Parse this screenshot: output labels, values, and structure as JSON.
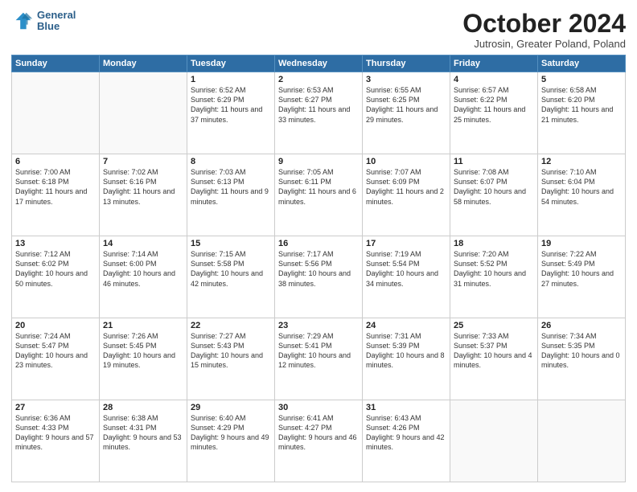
{
  "header": {
    "logo_line1": "General",
    "logo_line2": "Blue",
    "month": "October 2024",
    "location": "Jutrosin, Greater Poland, Poland"
  },
  "days_of_week": [
    "Sunday",
    "Monday",
    "Tuesday",
    "Wednesday",
    "Thursday",
    "Friday",
    "Saturday"
  ],
  "weeks": [
    [
      {
        "day": "",
        "empty": true
      },
      {
        "day": "",
        "empty": true
      },
      {
        "day": "1",
        "sunrise": "6:52 AM",
        "sunset": "6:29 PM",
        "daylight": "11 hours and 37 minutes."
      },
      {
        "day": "2",
        "sunrise": "6:53 AM",
        "sunset": "6:27 PM",
        "daylight": "11 hours and 33 minutes."
      },
      {
        "day": "3",
        "sunrise": "6:55 AM",
        "sunset": "6:25 PM",
        "daylight": "11 hours and 29 minutes."
      },
      {
        "day": "4",
        "sunrise": "6:57 AM",
        "sunset": "6:22 PM",
        "daylight": "11 hours and 25 minutes."
      },
      {
        "day": "5",
        "sunrise": "6:58 AM",
        "sunset": "6:20 PM",
        "daylight": "11 hours and 21 minutes."
      }
    ],
    [
      {
        "day": "6",
        "sunrise": "7:00 AM",
        "sunset": "6:18 PM",
        "daylight": "11 hours and 17 minutes."
      },
      {
        "day": "7",
        "sunrise": "7:02 AM",
        "sunset": "6:16 PM",
        "daylight": "11 hours and 13 minutes."
      },
      {
        "day": "8",
        "sunrise": "7:03 AM",
        "sunset": "6:13 PM",
        "daylight": "11 hours and 9 minutes."
      },
      {
        "day": "9",
        "sunrise": "7:05 AM",
        "sunset": "6:11 PM",
        "daylight": "11 hours and 6 minutes."
      },
      {
        "day": "10",
        "sunrise": "7:07 AM",
        "sunset": "6:09 PM",
        "daylight": "11 hours and 2 minutes."
      },
      {
        "day": "11",
        "sunrise": "7:08 AM",
        "sunset": "6:07 PM",
        "daylight": "10 hours and 58 minutes."
      },
      {
        "day": "12",
        "sunrise": "7:10 AM",
        "sunset": "6:04 PM",
        "daylight": "10 hours and 54 minutes."
      }
    ],
    [
      {
        "day": "13",
        "sunrise": "7:12 AM",
        "sunset": "6:02 PM",
        "daylight": "10 hours and 50 minutes."
      },
      {
        "day": "14",
        "sunrise": "7:14 AM",
        "sunset": "6:00 PM",
        "daylight": "10 hours and 46 minutes."
      },
      {
        "day": "15",
        "sunrise": "7:15 AM",
        "sunset": "5:58 PM",
        "daylight": "10 hours and 42 minutes."
      },
      {
        "day": "16",
        "sunrise": "7:17 AM",
        "sunset": "5:56 PM",
        "daylight": "10 hours and 38 minutes."
      },
      {
        "day": "17",
        "sunrise": "7:19 AM",
        "sunset": "5:54 PM",
        "daylight": "10 hours and 34 minutes."
      },
      {
        "day": "18",
        "sunrise": "7:20 AM",
        "sunset": "5:52 PM",
        "daylight": "10 hours and 31 minutes."
      },
      {
        "day": "19",
        "sunrise": "7:22 AM",
        "sunset": "5:49 PM",
        "daylight": "10 hours and 27 minutes."
      }
    ],
    [
      {
        "day": "20",
        "sunrise": "7:24 AM",
        "sunset": "5:47 PM",
        "daylight": "10 hours and 23 minutes."
      },
      {
        "day": "21",
        "sunrise": "7:26 AM",
        "sunset": "5:45 PM",
        "daylight": "10 hours and 19 minutes."
      },
      {
        "day": "22",
        "sunrise": "7:27 AM",
        "sunset": "5:43 PM",
        "daylight": "10 hours and 15 minutes."
      },
      {
        "day": "23",
        "sunrise": "7:29 AM",
        "sunset": "5:41 PM",
        "daylight": "10 hours and 12 minutes."
      },
      {
        "day": "24",
        "sunrise": "7:31 AM",
        "sunset": "5:39 PM",
        "daylight": "10 hours and 8 minutes."
      },
      {
        "day": "25",
        "sunrise": "7:33 AM",
        "sunset": "5:37 PM",
        "daylight": "10 hours and 4 minutes."
      },
      {
        "day": "26",
        "sunrise": "7:34 AM",
        "sunset": "5:35 PM",
        "daylight": "10 hours and 0 minutes."
      }
    ],
    [
      {
        "day": "27",
        "sunrise": "6:36 AM",
        "sunset": "4:33 PM",
        "daylight": "9 hours and 57 minutes."
      },
      {
        "day": "28",
        "sunrise": "6:38 AM",
        "sunset": "4:31 PM",
        "daylight": "9 hours and 53 minutes."
      },
      {
        "day": "29",
        "sunrise": "6:40 AM",
        "sunset": "4:29 PM",
        "daylight": "9 hours and 49 minutes."
      },
      {
        "day": "30",
        "sunrise": "6:41 AM",
        "sunset": "4:27 PM",
        "daylight": "9 hours and 46 minutes."
      },
      {
        "day": "31",
        "sunrise": "6:43 AM",
        "sunset": "4:26 PM",
        "daylight": "9 hours and 42 minutes."
      },
      {
        "day": "",
        "empty": true
      },
      {
        "day": "",
        "empty": true
      }
    ]
  ]
}
